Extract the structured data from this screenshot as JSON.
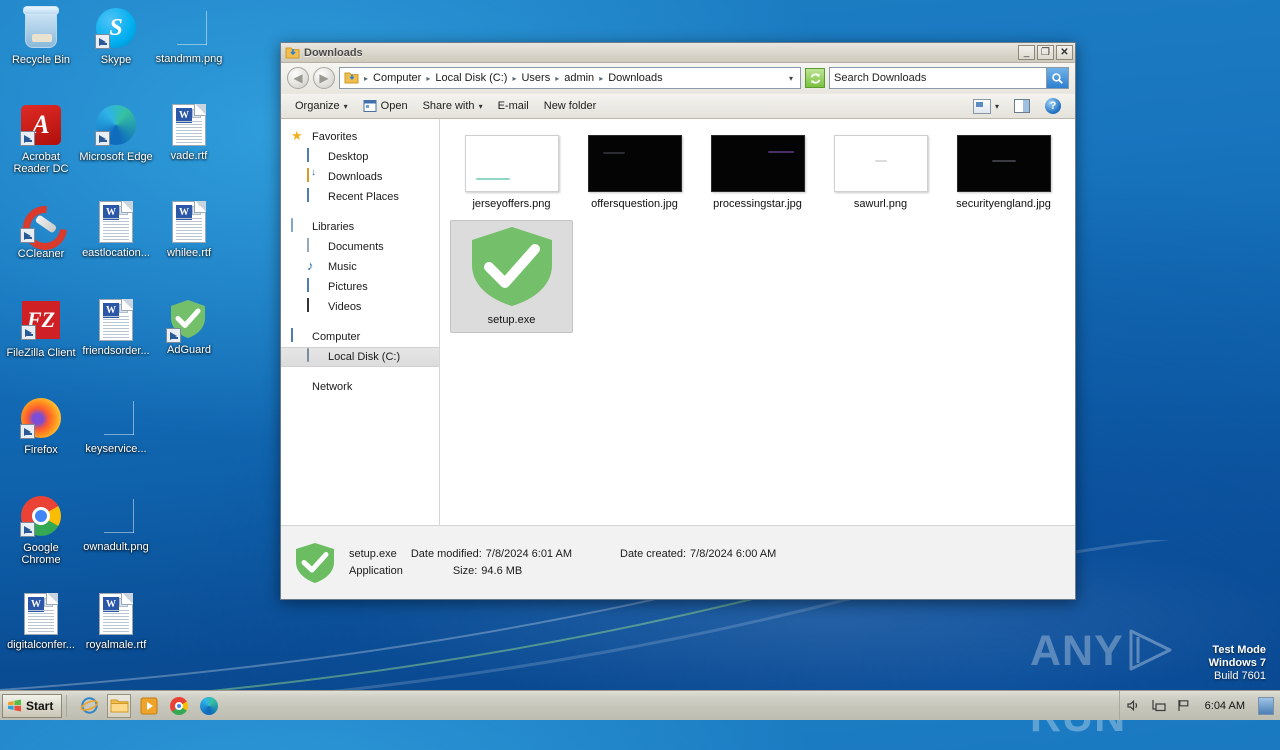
{
  "desktop": {
    "icons": [
      {
        "label": "Recycle Bin",
        "icon": "recycle-bin-icon",
        "shortcut": false
      },
      {
        "label": "Skype",
        "icon": "skype-icon",
        "shortcut": true
      },
      {
        "label": "standmm.png",
        "icon": "image-file-icon",
        "shortcut": false
      },
      {
        "label": "Acrobat Reader DC",
        "icon": "acrobat-reader-icon",
        "shortcut": true
      },
      {
        "label": "Microsoft Edge",
        "icon": "edge-icon",
        "shortcut": true
      },
      {
        "label": "vade.rtf",
        "icon": "rtf-document-icon",
        "shortcut": false
      },
      {
        "label": "CCleaner",
        "icon": "ccleaner-icon",
        "shortcut": true
      },
      {
        "label": "eastlocation...",
        "icon": "rtf-document-icon",
        "shortcut": false
      },
      {
        "label": "whilee.rtf",
        "icon": "rtf-document-icon",
        "shortcut": false
      },
      {
        "label": "FileZilla Client",
        "icon": "filezilla-icon",
        "shortcut": true
      },
      {
        "label": "friendsorder...",
        "icon": "rtf-document-icon",
        "shortcut": false
      },
      {
        "label": "AdGuard",
        "icon": "adguard-shield-icon",
        "shortcut": true
      },
      {
        "label": "Firefox",
        "icon": "firefox-icon",
        "shortcut": true
      },
      {
        "label": "keyservice...",
        "icon": "image-file-icon",
        "shortcut": false
      },
      {
        "label": "Google Chrome",
        "icon": "chrome-icon",
        "shortcut": true
      },
      {
        "label": "ownadult.png",
        "icon": "image-file-icon",
        "shortcut": false
      },
      {
        "label": "digitalconfer...",
        "icon": "rtf-document-icon",
        "shortcut": false
      },
      {
        "label": "royalmale.rtf",
        "icon": "rtf-document-icon",
        "shortcut": false
      }
    ]
  },
  "window": {
    "title": "Downloads",
    "icon": "downloads-folder-icon",
    "controls": {
      "minimize": "_",
      "maximize": "❐",
      "close": "✕"
    },
    "address": {
      "back_icon": "back-arrow-icon",
      "forward_icon": "forward-arrow-icon",
      "folder_icon": "downloads-folder-icon",
      "crumbs": [
        "Computer",
        "Local Disk (C:)",
        "Users",
        "admin",
        "Downloads"
      ],
      "separator": "▸",
      "history_arrow": "▾",
      "refresh_icon": "refresh-icon"
    },
    "search": {
      "value": "Search Downloads",
      "placeholder": "Search Downloads",
      "button_icon": "search-icon"
    },
    "toolbar": {
      "organize": "Organize",
      "open": "Open",
      "share_with": "Share with",
      "email": "E-mail",
      "new_folder": "New folder",
      "caret": "▾",
      "view_icon": "view-mode-icon",
      "pane_icon": "preview-pane-icon",
      "help_icon": "help-icon"
    },
    "nav": {
      "groups": [
        {
          "header": {
            "label": "Favorites",
            "icon": "favorites-star-icon"
          },
          "items": [
            {
              "label": "Desktop",
              "icon": "desktop-icon"
            },
            {
              "label": "Downloads",
              "icon": "downloads-folder-icon"
            },
            {
              "label": "Recent Places",
              "icon": "recent-places-icon"
            }
          ]
        },
        {
          "header": {
            "label": "Libraries",
            "icon": "libraries-icon"
          },
          "items": [
            {
              "label": "Documents",
              "icon": "documents-icon"
            },
            {
              "label": "Music",
              "icon": "music-icon"
            },
            {
              "label": "Pictures",
              "icon": "pictures-icon"
            },
            {
              "label": "Videos",
              "icon": "videos-icon"
            }
          ]
        },
        {
          "header": {
            "label": "Computer",
            "icon": "computer-icon"
          },
          "items": [
            {
              "label": "Local Disk (C:)",
              "icon": "local-disk-icon",
              "selected": true
            }
          ]
        },
        {
          "header": {
            "label": "Network",
            "icon": "network-icon"
          },
          "items": []
        }
      ]
    },
    "files": [
      {
        "name": "jerseyoffers.png",
        "thumb": "light",
        "selected": false
      },
      {
        "name": "offersquestion.jpg",
        "thumb": "dark",
        "selected": false
      },
      {
        "name": "processingstar.jpg",
        "thumb": "dark",
        "selected": false
      },
      {
        "name": "sawurl.png",
        "thumb": "light",
        "selected": false
      },
      {
        "name": "securityengland.jpg",
        "thumb": "dark",
        "selected": false
      },
      {
        "name": "setup.exe",
        "thumb": "shield",
        "selected": true
      }
    ],
    "details": {
      "icon": "adguard-shield-icon",
      "name": "setup.exe",
      "type": "Application",
      "date_modified_label": "Date modified:",
      "date_modified": "7/8/2024 6:01 AM",
      "size_label": "Size:",
      "size": "94.6 MB",
      "date_created_label": "Date created:",
      "date_created": "7/8/2024 6:00 AM"
    }
  },
  "watermark": {
    "any": "ANY",
    "run": "RUN",
    "play_icon": "play-triangle-icon",
    "test_mode": "Test Mode",
    "os": "Windows 7",
    "build": "Build 7601"
  },
  "taskbar": {
    "start": "Start",
    "start_icon": "windows-logo-icon",
    "quicklaunch": [
      {
        "name": "internet-explorer-icon",
        "active": false
      },
      {
        "name": "windows-explorer-icon",
        "active": true
      },
      {
        "name": "media-player-icon",
        "active": false
      },
      {
        "name": "chrome-icon",
        "active": false
      },
      {
        "name": "edge-icon",
        "active": false
      }
    ],
    "tray": [
      {
        "name": "volume-icon",
        "glyph": "◁»"
      },
      {
        "name": "network-icon",
        "glyph": "🖧"
      },
      {
        "name": "action-center-flag-icon",
        "glyph": "⚑"
      }
    ],
    "clock": "6:04 AM",
    "show_desktop_icon": "show-desktop-icon"
  },
  "colors": {
    "accent": "#1d7fc4",
    "shield_green": "#68bd5f",
    "selection": "#dcdcdc"
  }
}
